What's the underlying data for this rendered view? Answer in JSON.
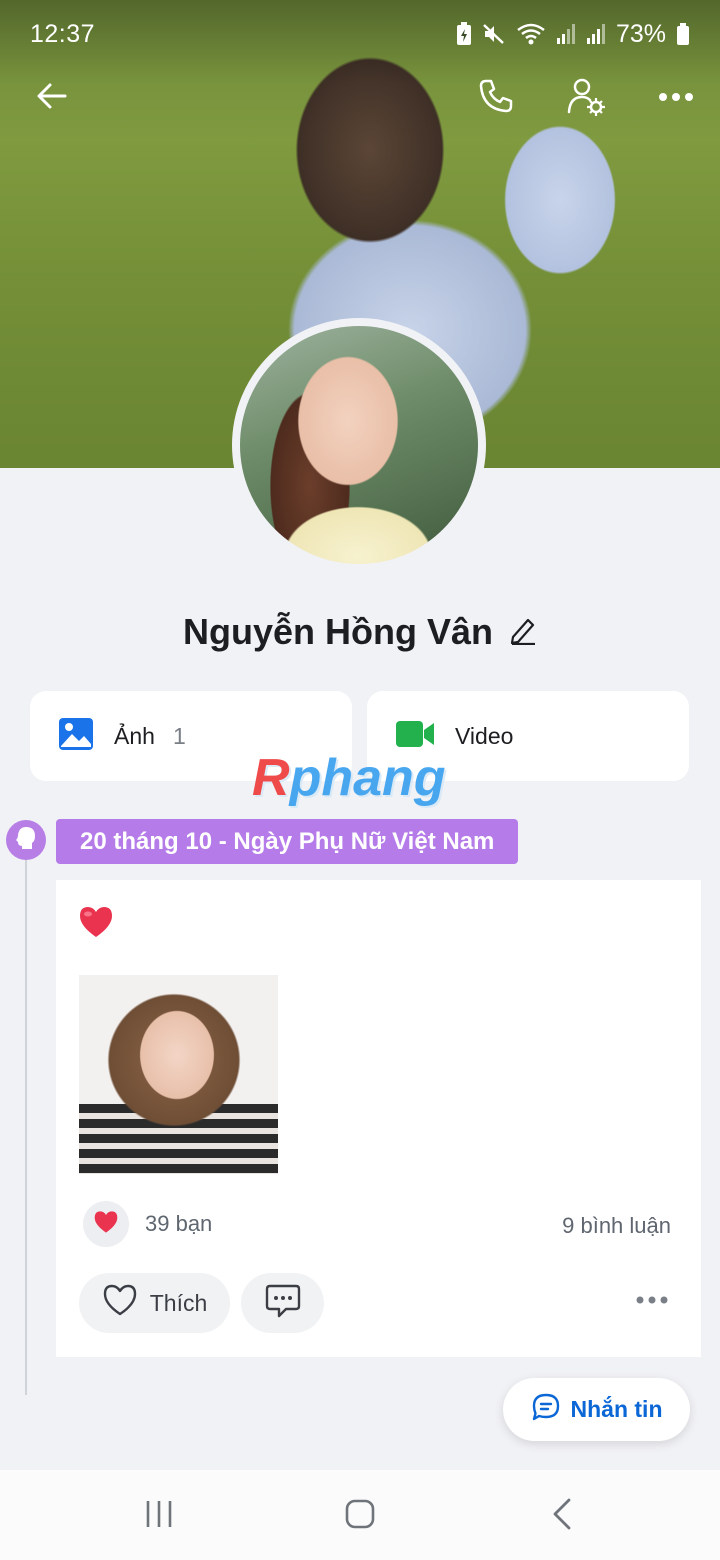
{
  "status_bar": {
    "time": "12:37",
    "battery_text": "73%",
    "icons": [
      "battery-saver-icon",
      "mute-icon",
      "wifi-icon",
      "signal-icon",
      "signal-icon",
      "battery-icon"
    ]
  },
  "top_nav": {
    "icons": [
      "back-arrow-icon",
      "phone-icon",
      "user-settings-icon",
      "more-icon"
    ]
  },
  "profile": {
    "name": "Nguyễn Hồng Vân"
  },
  "media": {
    "photos_label": "Ảnh",
    "photos_count": "1",
    "video_label": "Video"
  },
  "watermark": {
    "first": "R",
    "rest": "phang"
  },
  "post": {
    "event_tag": "20 tháng 10 - Ngày Phụ Nữ Việt Nam",
    "reactions_count": "39 bạn",
    "comments_count": "9 bình luận",
    "like_label": "Thích"
  },
  "message_button": {
    "label": "Nhắn tin"
  },
  "colors": {
    "accent_blue": "#0b67d6",
    "event_purple": "#b57ce9",
    "heart_red": "#e9334f",
    "video_green": "#22b14c"
  }
}
